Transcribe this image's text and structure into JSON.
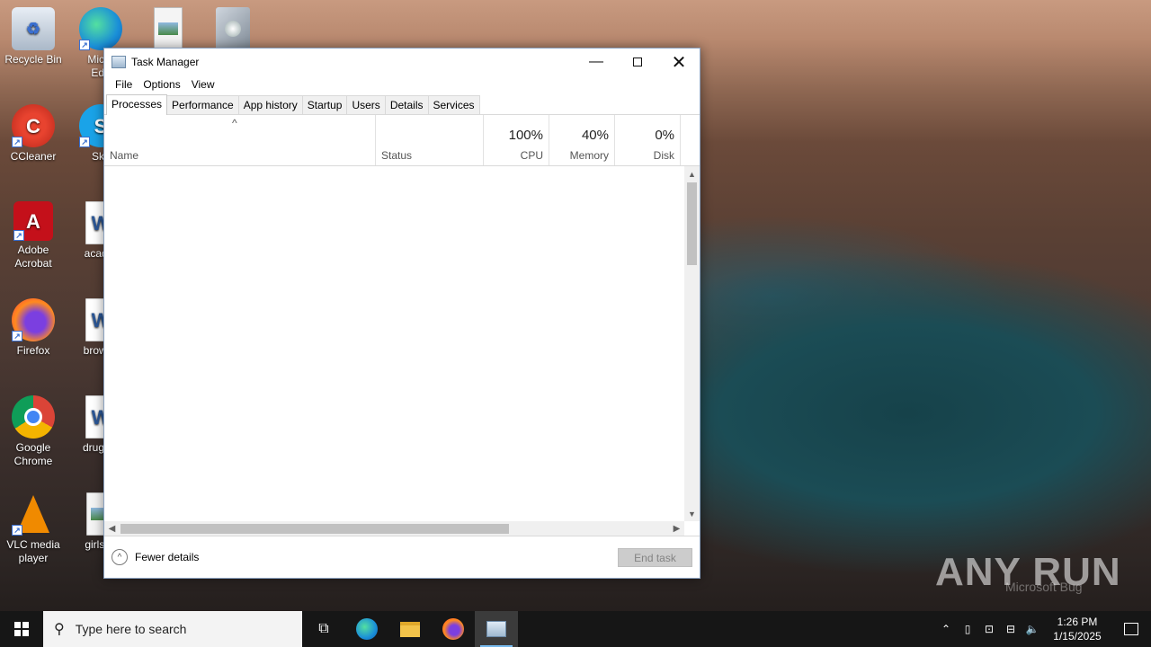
{
  "desktop": {
    "icons": [
      {
        "label": "Recycle Bin"
      },
      {
        "label": "Micro\nEdg"
      },
      {
        "label": ""
      },
      {
        "label": ""
      },
      {
        "label": "CCleaner"
      },
      {
        "label": "Sky"
      },
      {
        "label": "Adobe\nAcrobat"
      },
      {
        "label": "acader"
      },
      {
        "label": "Firefox"
      },
      {
        "label": "browse"
      },
      {
        "label": "Google\nChrome"
      },
      {
        "label": "drugsta"
      },
      {
        "label": "VLC media\nplayer"
      },
      {
        "label": "girlsen"
      }
    ],
    "watermark": "ANY RUN",
    "watermark_sub": "Microsoft Bug"
  },
  "window": {
    "title": "Task Manager",
    "menu": [
      "File",
      "Options",
      "View"
    ],
    "tabs": [
      "Processes",
      "Performance",
      "App history",
      "Startup",
      "Users",
      "Details",
      "Services"
    ],
    "active_tab": "Processes",
    "columns": {
      "name": "Name",
      "status": "Status",
      "cpu": {
        "pct": "100%",
        "label": "CPU"
      },
      "memory": {
        "pct": "40%",
        "label": "Memory"
      },
      "disk": {
        "pct": "0%",
        "label": "Disk"
      }
    },
    "footer": {
      "fewer_details": "Fewer details",
      "end_task": "End task"
    }
  },
  "taskbar": {
    "search_placeholder": "Type here to search",
    "time": "1:26 PM",
    "date": "1/15/2025"
  }
}
